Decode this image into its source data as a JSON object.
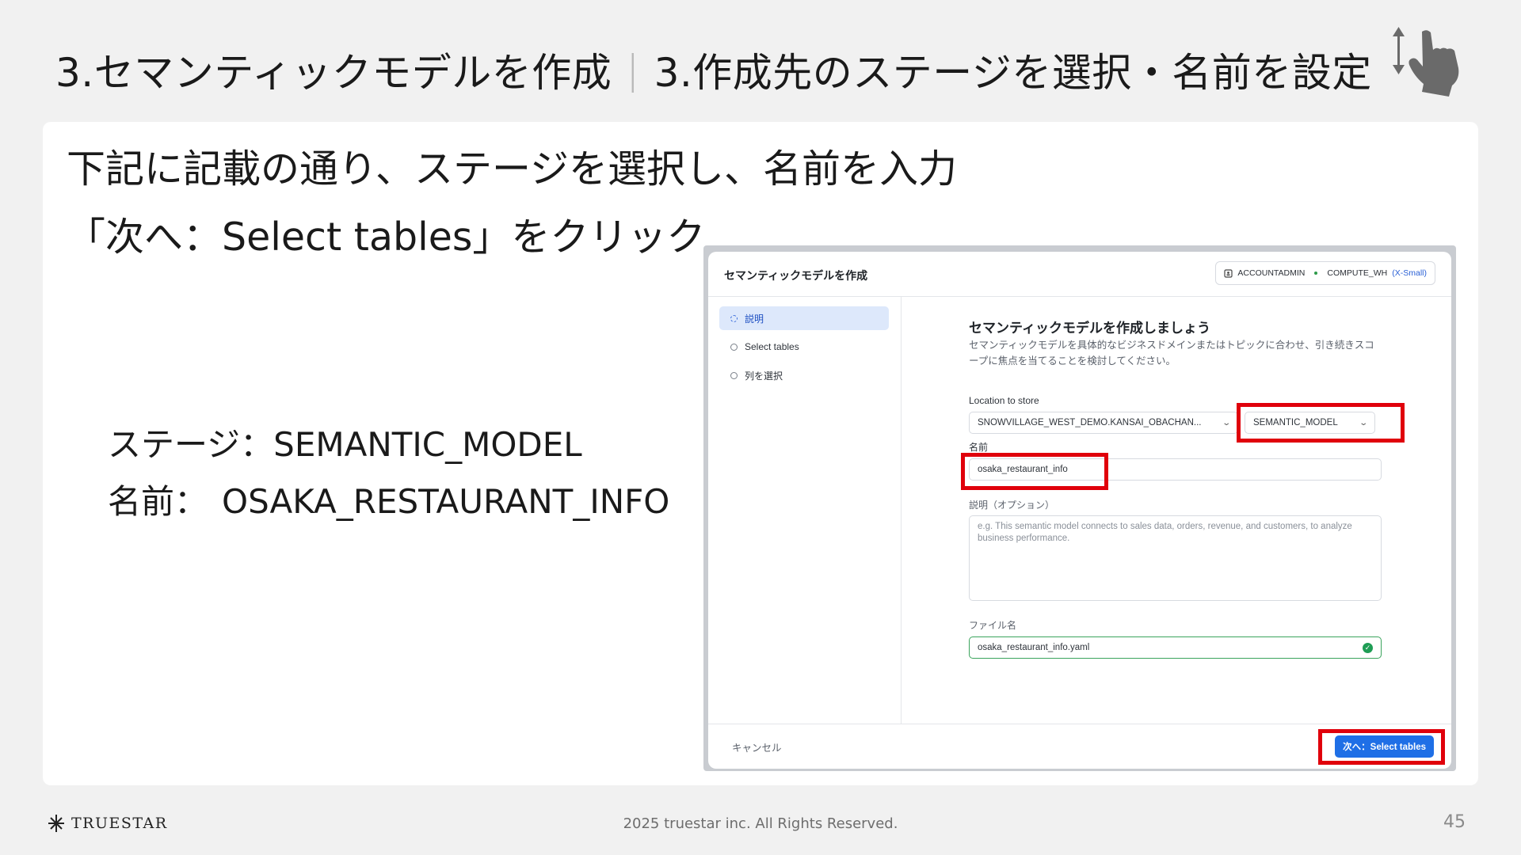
{
  "slide": {
    "title_left": "3.セマンティックモデルを作成",
    "title_sep": "|",
    "title_right": "3.作成先のステージを選択・名前を設定",
    "instruction1": "下記に記載の通り、ステージを選択し、名前を入力",
    "instruction2": "「次へ：Select tables」をクリック",
    "stage_line": "ステージ：SEMANTIC_MODEL",
    "name_label": "名前：",
    "name_value": "OSAKA_RESTAURANT_INFO"
  },
  "dialog": {
    "title": "セマンティックモデルを作成",
    "role": "ACCOUNTADMIN",
    "warehouse": "COMPUTE_WH",
    "warehouse_size": "(X-Small)",
    "steps": [
      {
        "label": "説明",
        "active": true
      },
      {
        "label": "Select tables",
        "active": false
      },
      {
        "label": "列を選択",
        "active": false
      }
    ],
    "main_title": "セマンティックモデルを作成しましょう",
    "main_desc": "セマンティックモデルを具体的なビジネスドメインまたはトピックに合わせ、引き続きスコープに焦点を当てることを検討してください。",
    "location_label": "Location to store",
    "location_value": "SNOWVILLAGE_WEST_DEMO.KANSAI_OBACHAN...",
    "stage_value": "SEMANTIC_MODEL",
    "name_label": "名前",
    "name_value": "osaka_restaurant_info",
    "description_label": "説明（オプション）",
    "description_placeholder": "e.g. This semantic model connects to sales data, orders, revenue, and customers, to analyze business performance.",
    "filename_label": "ファイル名",
    "filename_value": "osaka_restaurant_info.yaml",
    "cancel_label": "キャンセル",
    "next_label": "次へ：Select tables"
  },
  "footer": {
    "logo": "TRUESTAR",
    "copyright": "2025 truestar inc. All Rights Reserved.",
    "page": "45"
  },
  "colors": {
    "highlight": "#e0000b",
    "primary_button": "#1f6fe6",
    "active_step_bg": "#dde8fb"
  }
}
